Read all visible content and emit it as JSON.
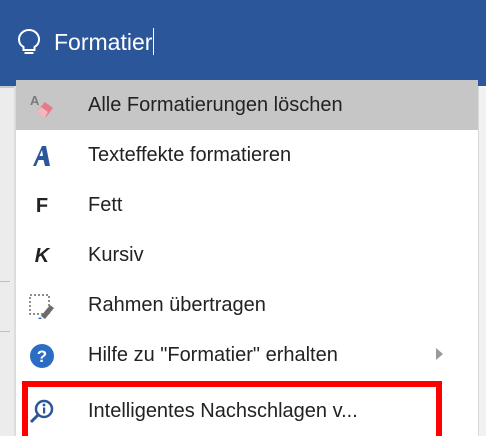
{
  "search": {
    "value": "Formatier",
    "icon": "lightbulb-icon"
  },
  "colors": {
    "header": "#2b579a",
    "highlight": "#c6c6c6",
    "help": "#2b6cc4",
    "frame": "#ff0000"
  },
  "menu": {
    "items": [
      {
        "label": "Alle Formatierungen löschen",
        "icon": "eraser-icon"
      },
      {
        "label": "Texteffekte formatieren",
        "icon": "text-effects-icon"
      },
      {
        "label": "Fett",
        "icon": "bold-icon",
        "glyph": "F"
      },
      {
        "label": "Kursiv",
        "icon": "italic-icon",
        "glyph": "K"
      },
      {
        "label": "Rahmen übertragen",
        "icon": "border-painter-icon"
      },
      {
        "label": "Hilfe zu \"Formatier\" erhalten",
        "icon": "help-icon",
        "glyph": "?"
      },
      {
        "label": "Intelligentes Nachschlagen v...",
        "icon": "smart-lookup-icon"
      }
    ]
  }
}
